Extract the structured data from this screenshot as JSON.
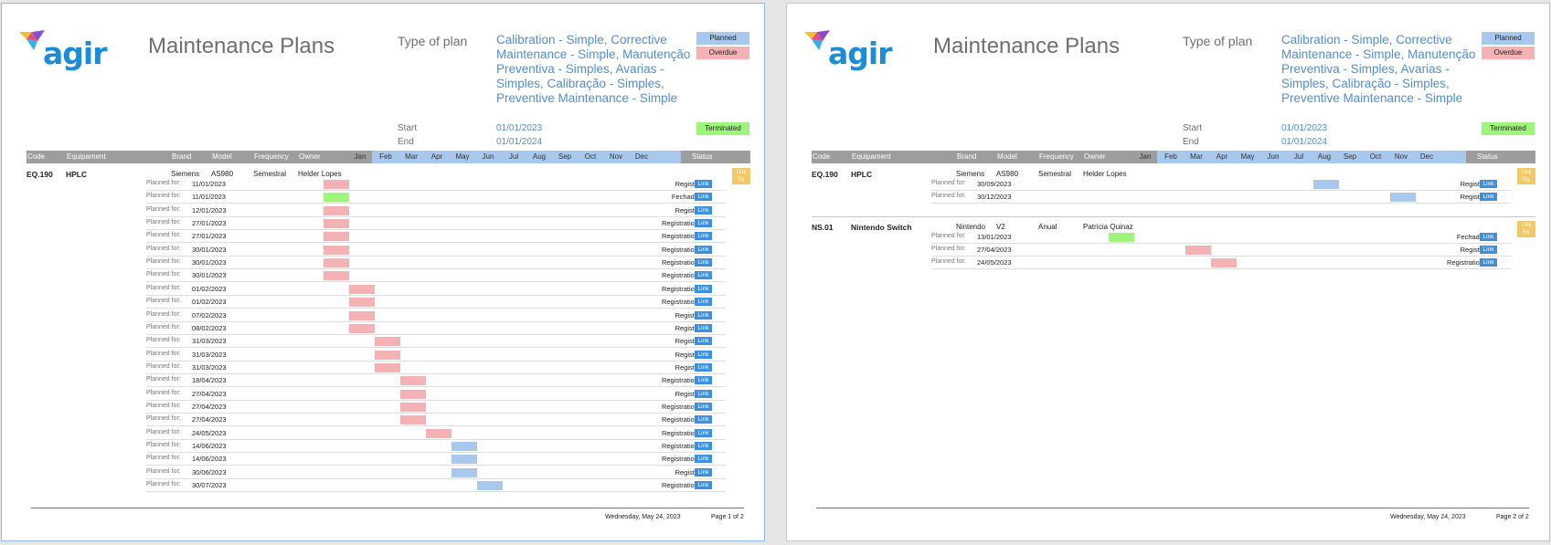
{
  "app": {
    "logo_text": "agir",
    "title": "Maintenance Plans"
  },
  "plan_type": {
    "label": "Type of plan",
    "value": "Calibration - Simple, Corrective Maintenance - Simple, Manutenção Preventiva - Simples, Avarias - Simples, Calibração - Simples, Preventive Maintenance - Simple"
  },
  "period": {
    "start_label": "Start",
    "start": "01/01/2023",
    "end_label": "End",
    "end": "01/01/2024"
  },
  "legend": {
    "planned": "Planned",
    "overdue": "Overdue",
    "terminated": "Terminated"
  },
  "colors": {
    "planned": "#a9c8ee",
    "overdue": "#f4b2b4",
    "terminated": "#9ef57c",
    "header": "#9d9d9d",
    "link": "#3d8fe0",
    "eq_link": "#f3c869"
  },
  "columns": {
    "code": "Code",
    "equipment": "Equipament",
    "brand": "Brand",
    "model": "Model",
    "frequency": "Frequency",
    "owner": "Owner",
    "status": "Status"
  },
  "months": [
    "Jan",
    "Feb",
    "Mar",
    "Apr",
    "May",
    "Jun",
    "Jul",
    "Aug",
    "Sep",
    "Oct",
    "Nov",
    "Dec"
  ],
  "planned_label": "Planned for:",
  "link_label": "Link",
  "eq_link_label": "Link Eq.",
  "pages": [
    {
      "footer_date": "Wednesday, May 24, 2023",
      "footer_page": "Page 1 of 2",
      "equipment": [
        {
          "code": "EQ.190",
          "name": "HPLC",
          "brand": "Siemens",
          "model": "AS980",
          "frequency": "Semestral",
          "owner": "Helder Lopes",
          "rows": [
            {
              "date": "11/01/2023",
              "month": 0,
              "kind": "overdue",
              "status": "Registo"
            },
            {
              "date": "11/01/2023",
              "month": 0,
              "kind": "term",
              "status": "Fechado"
            },
            {
              "date": "12/01/2023",
              "month": 0,
              "kind": "overdue",
              "status": "Registo"
            },
            {
              "date": "27/01/2023",
              "month": 0,
              "kind": "overdue",
              "status": "Registration"
            },
            {
              "date": "27/01/2023",
              "month": 0,
              "kind": "overdue",
              "status": "Registration"
            },
            {
              "date": "30/01/2023",
              "month": 0,
              "kind": "overdue",
              "status": "Registration"
            },
            {
              "date": "30/01/2023",
              "month": 0,
              "kind": "overdue",
              "status": "Registration"
            },
            {
              "date": "30/01/2023",
              "month": 0,
              "kind": "overdue",
              "status": "Registration"
            },
            {
              "date": "01/02/2023",
              "month": 1,
              "kind": "overdue",
              "status": "Registration"
            },
            {
              "date": "01/02/2023",
              "month": 1,
              "kind": "overdue",
              "status": "Registration"
            },
            {
              "date": "07/02/2023",
              "month": 1,
              "kind": "overdue",
              "status": "Registo"
            },
            {
              "date": "08/02/2023",
              "month": 1,
              "kind": "overdue",
              "status": "Registo"
            },
            {
              "date": "31/03/2023",
              "month": 2,
              "kind": "overdue",
              "status": "Registo"
            },
            {
              "date": "31/03/2023",
              "month": 2,
              "kind": "overdue",
              "status": "Registo"
            },
            {
              "date": "31/03/2023",
              "month": 2,
              "kind": "overdue",
              "status": "Registo"
            },
            {
              "date": "18/04/2023",
              "month": 3,
              "kind": "overdue",
              "status": "Registration"
            },
            {
              "date": "27/04/2023",
              "month": 3,
              "kind": "overdue",
              "status": "Registo"
            },
            {
              "date": "27/04/2023",
              "month": 3,
              "kind": "overdue",
              "status": "Registration"
            },
            {
              "date": "27/04/2023",
              "month": 3,
              "kind": "overdue",
              "status": "Registration"
            },
            {
              "date": "24/05/2023",
              "month": 4,
              "kind": "overdue",
              "status": "Registration"
            },
            {
              "date": "14/06/2023",
              "month": 5,
              "kind": "planned",
              "status": "Registration"
            },
            {
              "date": "14/06/2023",
              "month": 5,
              "kind": "planned",
              "status": "Registration"
            },
            {
              "date": "30/06/2023",
              "month": 5,
              "kind": "planned",
              "status": "Registo"
            },
            {
              "date": "30/07/2023",
              "month": 6,
              "kind": "planned",
              "status": "Registration"
            }
          ]
        }
      ]
    },
    {
      "footer_date": "Wednesday, May 24, 2023",
      "footer_page": "Page 2 of 2",
      "equipment": [
        {
          "code": "EQ.190",
          "name": "HPLC",
          "brand": "Siemens",
          "model": "AS980",
          "frequency": "Semestral",
          "owner": "Helder Lopes",
          "rows": [
            {
              "date": "30/09/2023",
              "month": 8,
              "kind": "planned",
              "status": "Registo"
            },
            {
              "date": "30/12/2023",
              "month": 11,
              "kind": "planned",
              "status": "Registo"
            }
          ]
        },
        {
          "code": "NS.01",
          "name": "Nintendo Switch",
          "brand": "Nintendo",
          "model": "V2",
          "frequency": "Anual",
          "owner": "Patrícia Quinaz",
          "rows": [
            {
              "date": "13/01/2023",
              "month": 0,
              "kind": "term",
              "status": "Fechado"
            },
            {
              "date": "27/04/2023",
              "month": 3,
              "kind": "overdue",
              "status": "Registo"
            },
            {
              "date": "24/05/2023",
              "month": 4,
              "kind": "overdue",
              "status": "Registration"
            }
          ]
        }
      ]
    }
  ]
}
